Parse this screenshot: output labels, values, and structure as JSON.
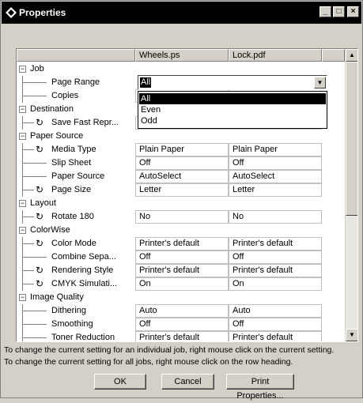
{
  "window": {
    "title": "Properties",
    "minimize": "_",
    "maximize": "□",
    "close": "×"
  },
  "grid": {
    "columns": [
      "Wheels.ps",
      "Lock.pdf"
    ],
    "dropdown": {
      "value": "All",
      "options": [
        "All",
        "Even",
        "Odd"
      ],
      "selected_index": 0
    },
    "rows": [
      {
        "type": "group",
        "label": "Job"
      },
      {
        "type": "item",
        "label": "Page Range",
        "values": [
          "",
          ""
        ],
        "dropdown": true
      },
      {
        "type": "item",
        "label": "Copies",
        "values": [
          "",
          ""
        ]
      },
      {
        "type": "group",
        "label": "Destination"
      },
      {
        "type": "item",
        "label": "Save Fast Repr...",
        "values": [
          "",
          ""
        ],
        "icon": "refresh"
      },
      {
        "type": "group",
        "label": "Paper Source"
      },
      {
        "type": "item",
        "label": "Media Type",
        "values": [
          "Plain Paper",
          "Plain Paper"
        ],
        "icon": "refresh"
      },
      {
        "type": "item",
        "label": "Slip Sheet",
        "values": [
          "Off",
          "Off"
        ]
      },
      {
        "type": "item",
        "label": "Paper Source",
        "values": [
          "AutoSelect",
          "AutoSelect"
        ]
      },
      {
        "type": "item",
        "label": "Page Size",
        "values": [
          "Letter",
          "Letter"
        ],
        "icon": "refresh"
      },
      {
        "type": "group",
        "label": "Layout"
      },
      {
        "type": "item",
        "label": "Rotate 180",
        "values": [
          "No",
          "No"
        ],
        "icon": "refresh"
      },
      {
        "type": "group",
        "label": "ColorWise"
      },
      {
        "type": "item",
        "label": "Color Mode",
        "values": [
          "Printer's default",
          "Printer's default"
        ],
        "icon": "refresh"
      },
      {
        "type": "item",
        "label": "Combine Sepa...",
        "values": [
          "Off",
          "Off"
        ]
      },
      {
        "type": "item",
        "label": "Rendering Style",
        "values": [
          "Printer's default",
          "Printer's default"
        ],
        "icon": "refresh"
      },
      {
        "type": "item",
        "label": "CMYK Simulati...",
        "values": [
          "On",
          "On"
        ],
        "icon": "refresh"
      },
      {
        "type": "group",
        "label": "Image Quality"
      },
      {
        "type": "item",
        "label": "Dithering",
        "values": [
          "Auto",
          "Auto"
        ]
      },
      {
        "type": "item",
        "label": "Smoothing",
        "values": [
          "Off",
          "Off"
        ]
      },
      {
        "type": "item",
        "label": "Toner Reduction",
        "values": [
          "Printer's default",
          "Printer's default"
        ]
      }
    ]
  },
  "footer": {
    "line1": "To change the current setting for an individual job, right mouse click on the current setting.",
    "line2": "To change the current setting for all jobs, right mouse click on the row heading."
  },
  "buttons": {
    "ok": "OK",
    "cancel": "Cancel",
    "print_properties": "Print Properties..."
  }
}
